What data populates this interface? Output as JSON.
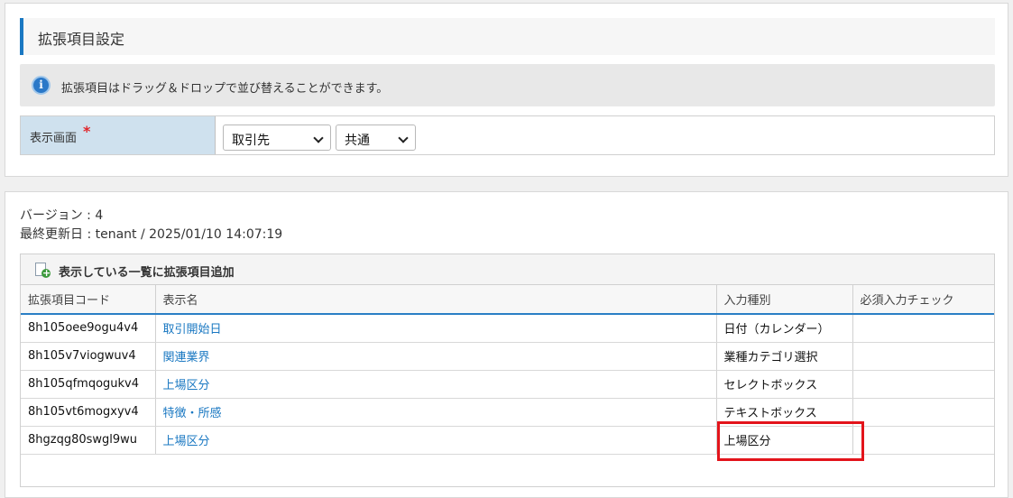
{
  "page": {
    "title": "拡張項目設定"
  },
  "info": {
    "message": "拡張項目はドラッグ＆ドロップで並び替えることができます。"
  },
  "form": {
    "display_label": "表示画面",
    "required_mark": "*",
    "select1": "取引先",
    "select2": "共通"
  },
  "meta": {
    "version": "バージョン : 4",
    "updated": "最終更新日 : tenant / 2025/01/10 14:07:19"
  },
  "toolbar": {
    "add_label": "表示している一覧に拡張項目追加"
  },
  "table": {
    "headers": [
      "拡張項目コード",
      "表示名",
      "入力種別",
      "必須入力チェック"
    ],
    "rows": [
      {
        "code": "8h105oee9ogu4v4",
        "name": "取引開始日",
        "type": "日付（カレンダー）",
        "required": ""
      },
      {
        "code": "8h105v7viogwuv4",
        "name": "関連業界",
        "type": "業種カテゴリ選択",
        "required": ""
      },
      {
        "code": "8h105qfmqogukv4",
        "name": "上場区分",
        "type": "セレクトボックス",
        "required": ""
      },
      {
        "code": "8h105vt6mogxyv4",
        "name": "特徴・所感",
        "type": "テキストボックス",
        "required": ""
      },
      {
        "code": "8hgzqg80swgl9wu",
        "name": "上場区分",
        "type": "上場区分",
        "required": ""
      }
    ]
  },
  "colors": {
    "accent": "#1a78c2",
    "highlight": "#e3141b",
    "label_bg": "#cfe1ee"
  },
  "icons": {
    "info": "info-icon",
    "add": "add-document-icon",
    "dropdown": "chevron-down-icon"
  }
}
